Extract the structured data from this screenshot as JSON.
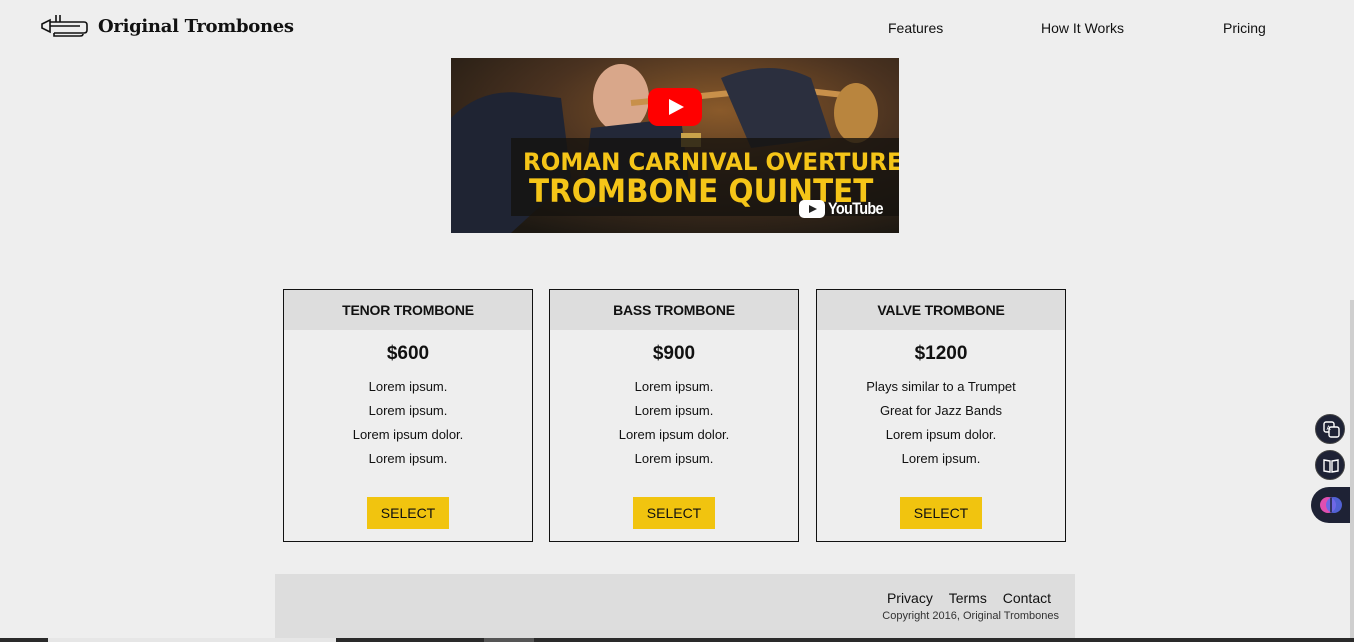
{
  "header": {
    "brand": "Original Trombones",
    "logo_icon": "trombone-icon",
    "nav": [
      {
        "label": "Features"
      },
      {
        "label": "How It Works"
      },
      {
        "label": "Pricing"
      }
    ]
  },
  "video": {
    "title_line1": "ROMAN CARNIVAL OVERTURE",
    "title_line2": "TROMBONE QUINTET",
    "platform": "YouTube",
    "accent_color": "#f5c518"
  },
  "pricing": {
    "cards": [
      {
        "name": "TENOR TROMBONE",
        "price": "$600",
        "features": [
          "Lorem ipsum.",
          "Lorem ipsum.",
          "Lorem ipsum dolor.",
          "Lorem ipsum."
        ],
        "button": "SELECT"
      },
      {
        "name": "BASS TROMBONE",
        "price": "$900",
        "features": [
          "Lorem ipsum.",
          "Lorem ipsum.",
          "Lorem ipsum dolor.",
          "Lorem ipsum."
        ],
        "button": "SELECT"
      },
      {
        "name": "VALVE TROMBONE",
        "price": "$1200",
        "features": [
          "Plays similar to a Trumpet",
          "Great for Jazz Bands",
          "Lorem ipsum dolor.",
          "Lorem ipsum."
        ],
        "button": "SELECT"
      }
    ],
    "button_color": "#f1c40f"
  },
  "footer": {
    "links": [
      {
        "label": "Privacy"
      },
      {
        "label": "Terms"
      },
      {
        "label": "Contact"
      }
    ],
    "copyright": "Copyright 2016, Original Trombones"
  },
  "side_widgets": [
    {
      "icon": "translate-icon"
    },
    {
      "icon": "reader-icon"
    },
    {
      "icon": "ai-brain-icon"
    }
  ]
}
